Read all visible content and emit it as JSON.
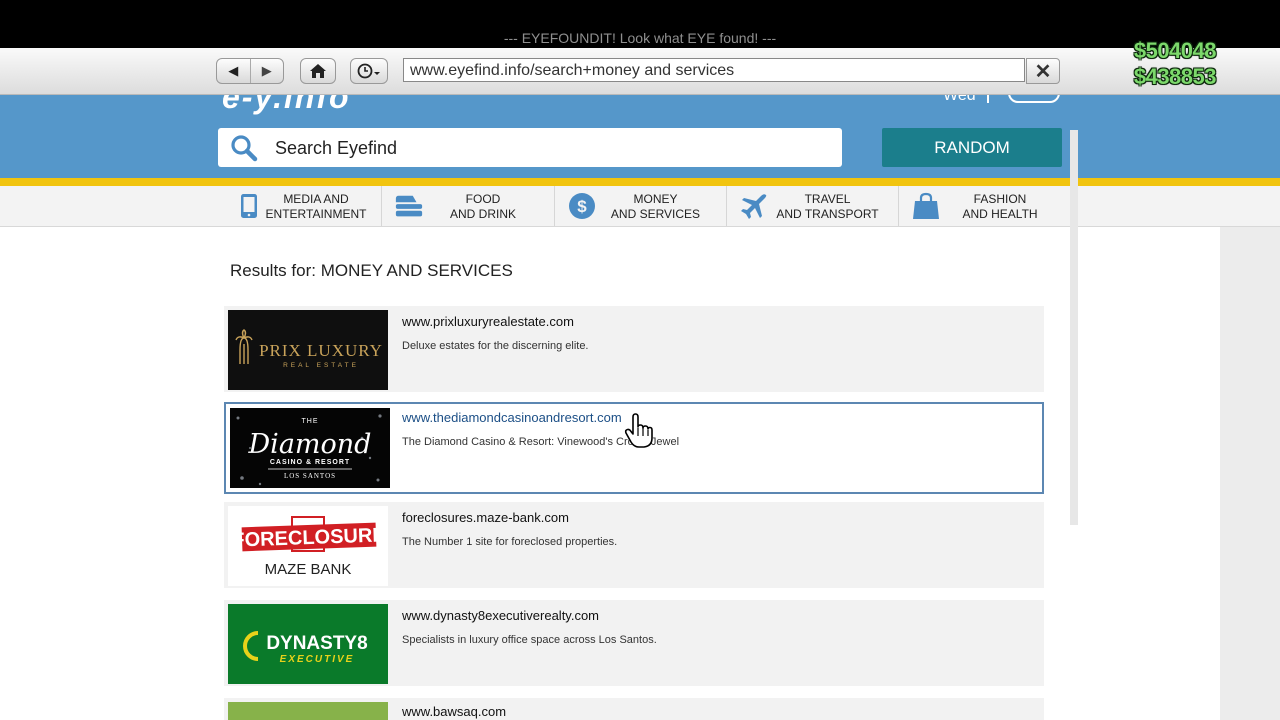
{
  "top_title": "--- EYEFOUNDIT! Look what EYE found! ---",
  "browser": {
    "url": "www.eyefind.info/search+money and services",
    "close_label": "✕",
    "back_label": "◀",
    "forward_label": "▶"
  },
  "money": {
    "cash": "$504048",
    "bank": "$438853"
  },
  "header": {
    "logo_fragment": "e-y.info",
    "day": "Wed",
    "search_placeholder": "Search Eyefind",
    "random_label": "RANDOM"
  },
  "categories": [
    {
      "label_1": "MEDIA AND",
      "label_2": "ENTERTAINMENT",
      "icon": "tablet-icon"
    },
    {
      "label_1": "FOOD",
      "label_2": "AND DRINK",
      "icon": "food-icon"
    },
    {
      "label_1": "MONEY",
      "label_2": "AND SERVICES",
      "icon": "dollar-icon"
    },
    {
      "label_1": "TRAVEL",
      "label_2": "AND TRANSPORT",
      "icon": "airplane-icon"
    },
    {
      "label_1": "FASHION",
      "label_2": "AND HEALTH",
      "icon": "shopping-bag-icon"
    }
  ],
  "results_title": "Results for: MONEY AND SERVICES",
  "results": [
    {
      "url": "www.prixluxuryrealestate.com",
      "desc": "Deluxe estates for the discerning elite.",
      "logo_line1": "PRIX LUXURY",
      "logo_line2": "REAL ESTATE"
    },
    {
      "url": "www.thediamondcasinoandresort.com",
      "desc": "The Diamond Casino & Resort: Vinewood's Crown Jewel",
      "logo_line1": "THE",
      "logo_line2": "Diamond",
      "logo_line3": "CASINO & RESORT",
      "logo_line4": "LOS SANTOS"
    },
    {
      "url": "foreclosures.maze-bank.com",
      "desc": "The Number 1 site for foreclosed properties.",
      "logo_line1": "FORECLOSURE",
      "logo_line2": "MAZE BANK"
    },
    {
      "url": "www.dynasty8executiverealty.com",
      "desc": "Specialists in luxury office space across Los Santos.",
      "logo_line1": "DYNASTY8",
      "logo_line2": "EXECUTIVE"
    },
    {
      "url": "www.bawsaq.com",
      "desc": ""
    }
  ],
  "colors": {
    "header_blue": "#5597ca",
    "accent_yellow": "#f1c40f",
    "random_teal": "#1b7e8c",
    "highlight_border": "#5c87b2",
    "money_green": "#7cd86b"
  }
}
